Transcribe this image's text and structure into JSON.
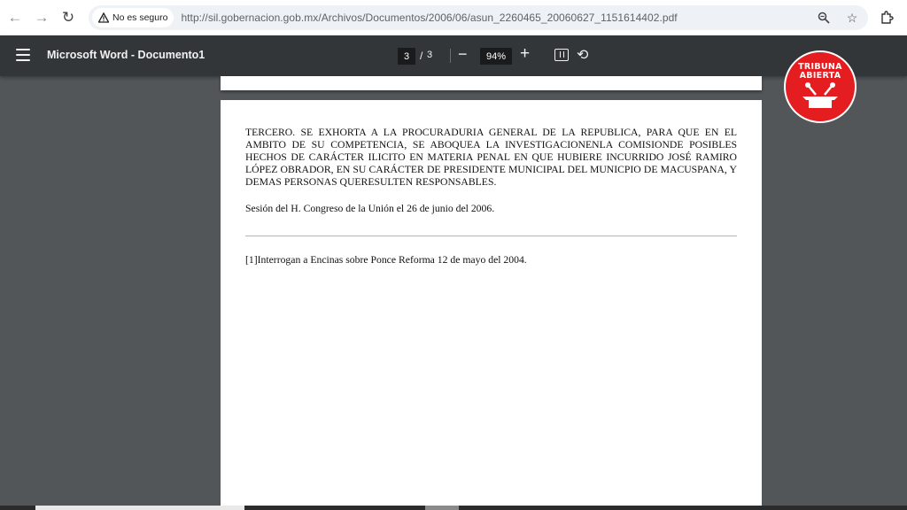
{
  "browser": {
    "security_chip": "No es seguro",
    "url": "http://sil.gobernacion.gob.mx/Archivos/Documentos/2006/06/asun_2260465_20060627_1151614402.pdf",
    "icons": [
      "back-icon",
      "forward-icon",
      "reload-icon",
      "zoom-icon",
      "star-icon",
      "extensions-icon"
    ]
  },
  "pdf_toolbar": {
    "title": "Microsoft Word - Documento1",
    "current_page": "3",
    "separator": "/",
    "total_pages": "3",
    "zoom": "94%",
    "zoom_out": "−",
    "zoom_in": "+"
  },
  "logo": {
    "line1": "TRIBUNA",
    "line2": "ABIERTA"
  },
  "document": {
    "paragraph_1": "TERCERO. SE EXHORTA A LA PROCURADURIA GENERAL DE LA REPUBLICA, PARA QUE EN EL AMBITO DE SU COMPETENCIA, SE ABOQUEA LA INVESTIGACIONENLA COMISIONDE POSIBLES HECHOS DE CARÁCTER ILICITO EN MATERIA PENAL EN QUE HUBIERE INCURRIDO JOSÉ RAMIRO LÓPEZ OBRADOR, EN SU CARÁCTER DE PRESIDENTE MUNICIPAL DEL MUNICPIO DE MACUSPANA, Y DEMAS PERSONAS QUERESULTEN RESPONSABLES.",
    "paragraph_2": "Sesión del H. Congreso de la Unión el 26 de junio del 2006.",
    "footnote": "[1]Interrogan a Encinas sobre Ponce Reforma 12 de mayo del 2004."
  }
}
